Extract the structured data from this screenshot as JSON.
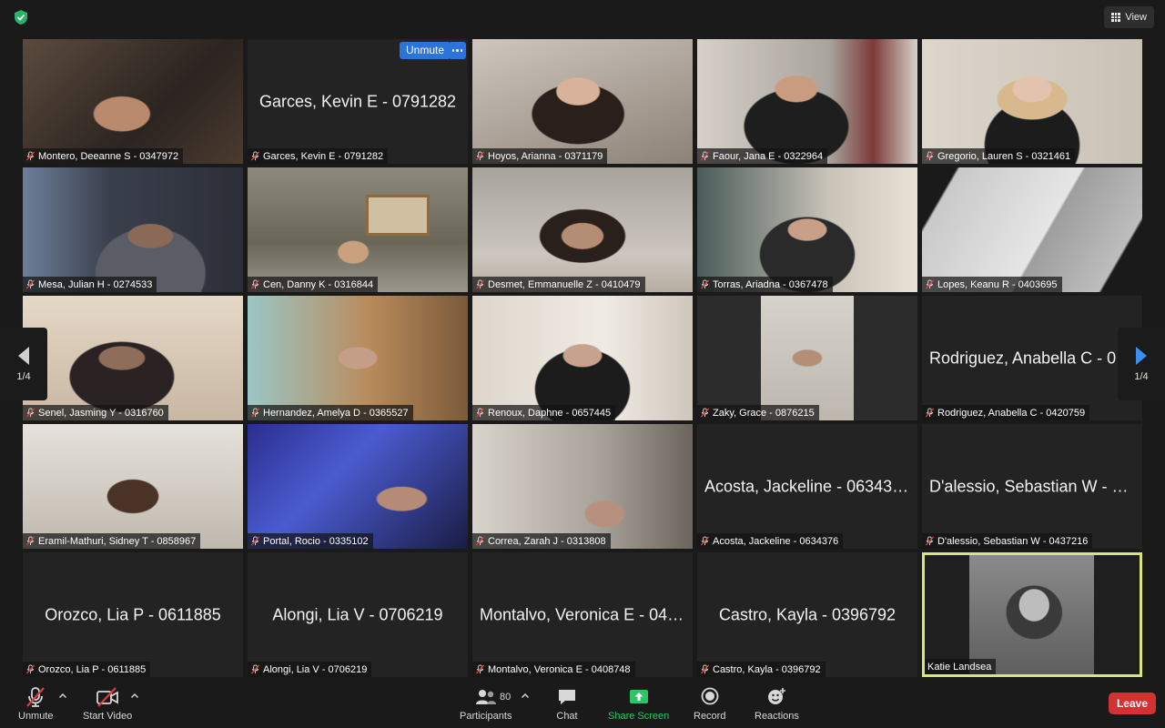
{
  "header": {
    "view_label": "View"
  },
  "pager": {
    "page_label": "1/4"
  },
  "tiles": [
    {
      "label": "Montero, Deeanne S - 0347972",
      "big": "",
      "video": "v1"
    },
    {
      "label": "Garces, Kevin E - 0791282",
      "big": "Garces, Kevin E - 0791282",
      "video": ""
    },
    {
      "label": "Hoyos, Arianna - 0371179",
      "big": "",
      "video": "v3"
    },
    {
      "label": "Faour, Jana E - 0322964",
      "big": "",
      "video": "v4"
    },
    {
      "label": "Gregorio, Lauren S - 0321461",
      "big": "",
      "video": "v5"
    },
    {
      "label": "Mesa, Julian H - 0274533",
      "big": "",
      "video": "v6"
    },
    {
      "label": "Cen, Danny K - 0316844",
      "big": "",
      "video": "v7"
    },
    {
      "label": "Desmet, Emmanuelle Z - 0410479",
      "big": "",
      "video": "v8"
    },
    {
      "label": "Torras, Ariadna - 0367478",
      "big": "",
      "video": "v9"
    },
    {
      "label": "Lopes, Keanu R - 0403695",
      "big": "",
      "video": "v10"
    },
    {
      "label": "Senel, Jasming Y - 0316760",
      "big": "",
      "video": "v11"
    },
    {
      "label": "Hernandez, Amelya D - 0365527",
      "big": "",
      "video": "v12"
    },
    {
      "label": "Renoux, Daphne - 0657445",
      "big": "",
      "video": "v13"
    },
    {
      "label": "Zaky, Grace - 0876215",
      "big": "",
      "video": "v14"
    },
    {
      "label": "Rodriguez, Anabella C - 0420759",
      "big": "Rodriguez, Anabella C - 04...",
      "video": ""
    },
    {
      "label": "Eramil-Mathuri, Sidney T - 0858967",
      "big": "",
      "video": "v16"
    },
    {
      "label": "Portal, Rocio - 0335102",
      "big": "",
      "video": "v17"
    },
    {
      "label": "Correa, Zarah J - 0313808",
      "big": "",
      "video": "v18"
    },
    {
      "label": "Acosta, Jackeline - 0634376",
      "big": "Acosta, Jackeline - 0634376",
      "video": ""
    },
    {
      "label": "D'alessio, Sebastian W - 0437216",
      "big": "D'alessio, Sebastian W - 04...",
      "video": ""
    },
    {
      "label": "Orozco, Lia P - 0611885",
      "big": "Orozco, Lia P - 0611885",
      "video": ""
    },
    {
      "label": "Alongi, Lia V - 0706219",
      "big": "Alongi, Lia V - 0706219",
      "video": ""
    },
    {
      "label": "Montalvo, Veronica E - 0408748",
      "big": "Montalvo, Veronica E - 040...",
      "video": ""
    },
    {
      "label": "Castro, Kayla - 0396792",
      "big": "Castro, Kayla - 0396792",
      "video": ""
    },
    {
      "label": "Katie Landsea",
      "big": "",
      "video": "v25",
      "active": true
    }
  ],
  "tile_actions": {
    "unmute_label": "Unmute"
  },
  "toolbar": {
    "unmute_label": "Unmute",
    "start_video_label": "Start Video",
    "participants_label": "Participants",
    "participants_count": "80",
    "chat_label": "Chat",
    "share_label": "Share Screen",
    "record_label": "Record",
    "reactions_label": "Reactions",
    "leave_label": "Leave"
  },
  "colors": {
    "accent_blue": "#2d74da",
    "share_green": "#2ec466",
    "leave_red": "#d13232",
    "active_speaker": "#d9e47a",
    "muted_red": "#e03c3c"
  }
}
